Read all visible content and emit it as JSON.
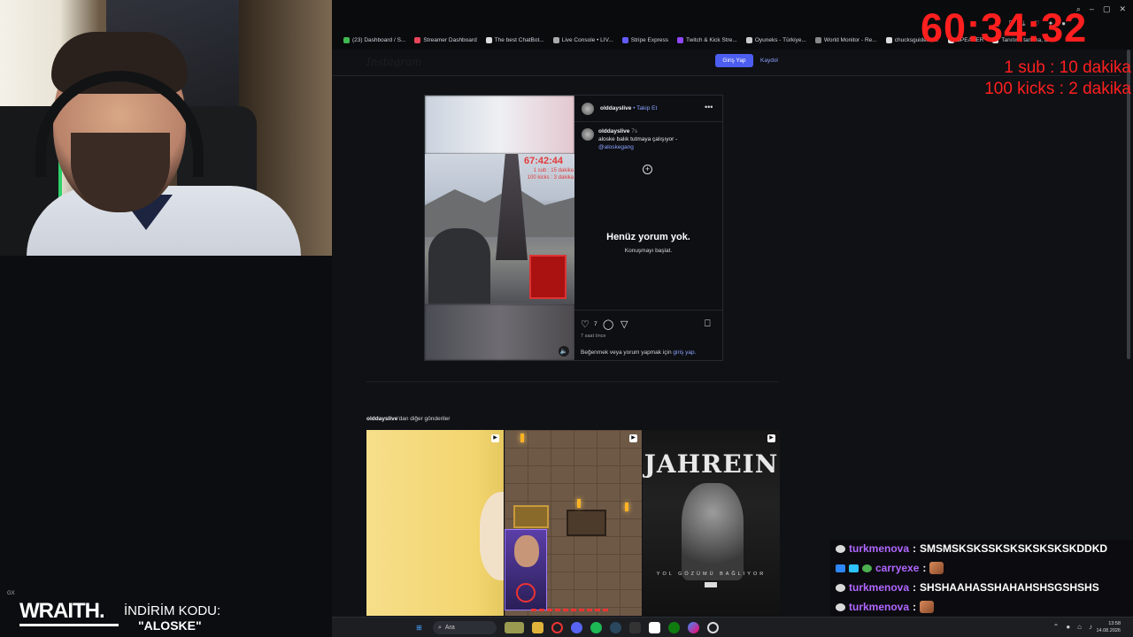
{
  "overlay": {
    "timer": "60:34:32",
    "sub_rate": "1 sub : 10 dakika",
    "kick_rate": "100 kicks : 2 dakika",
    "sponsor_brand": "WRAITH.",
    "sponsor_code_label": "İNDİRİM KODU:",
    "sponsor_code": "\"ALOSKE\"",
    "gx_label": "GX"
  },
  "browser": {
    "bookmarks": [
      {
        "label": "(23) Dashboard / S...",
        "color": "#3fb950"
      },
      {
        "label": "Streamer Dashboard",
        "color": "#e8445a"
      },
      {
        "label": "The best ChatBot...",
        "color": "#dddddd"
      },
      {
        "label": "Live Console • LIV...",
        "color": "#aaaaaa"
      },
      {
        "label": "Stripe Express",
        "color": "#635bff"
      },
      {
        "label": "Twitch & Kick Stre...",
        "color": "#9146ff"
      },
      {
        "label": "Oyuneks - Türkiye...",
        "color": "#cccccc"
      },
      {
        "label": "World Monitor - Re...",
        "color": "#888888"
      },
      {
        "label": "chucksguides.c...",
        "color": "#dddddd"
      },
      {
        "label": "SPEAKER",
        "color": "#dddddd"
      },
      {
        "label": "Tanıtım, tanıma, ta...",
        "color": "#dddddd"
      }
    ]
  },
  "instagram": {
    "logo": "Instagram",
    "login_button": "Giriş Yap",
    "signup_link": "Kaydol",
    "post": {
      "username": "olddayslive",
      "follow_label": "• Takip Et",
      "video_timer": "67:42:44",
      "video_sub_line1": "1 sub : 15 dakika",
      "video_sub_line2": "100 kicks : 3 dakika",
      "caption_user": "olddayslive",
      "caption_time": "7s",
      "caption_text": "aloske balık tutmaya çalışıyor -",
      "caption_tag": "@aloskegang",
      "no_comments": "Henüz yorum yok.",
      "start_conversation": "Konuşmayı başlat.",
      "likes": "7",
      "time_ago": "7 saat önce",
      "login_note": "Beğenmek veya yorum yapmak için",
      "login_link": "giriş yap."
    },
    "more_posts_user": "olddayslive",
    "more_posts_suffix": "'dan diğer gönderiler",
    "tiles": [
      {
        "title": ""
      },
      {
        "title": ""
      },
      {
        "title": "JAHREIN",
        "subtitle": "YOL GÖZÜMÜ BAĞLIYOR"
      }
    ]
  },
  "chat": {
    "messages": [
      {
        "user": "turkmenova",
        "text": "SMSMSKSKSSKSKSKSKSKSKDDKD",
        "emote": false
      },
      {
        "user": "carryexe",
        "text": "",
        "emote": true
      },
      {
        "user": "turkmenova",
        "text": "SHSHAAHASSHAHAHSHSGSHSHS",
        "emote": false
      },
      {
        "user": "turkmenova",
        "text": "",
        "emote": true
      },
      {
        "user": "turkmenova",
        "text": "",
        "emote": true
      }
    ]
  },
  "taskbar": {
    "search_label": "Ara",
    "time": "13:58",
    "date": "14.08.2026"
  }
}
